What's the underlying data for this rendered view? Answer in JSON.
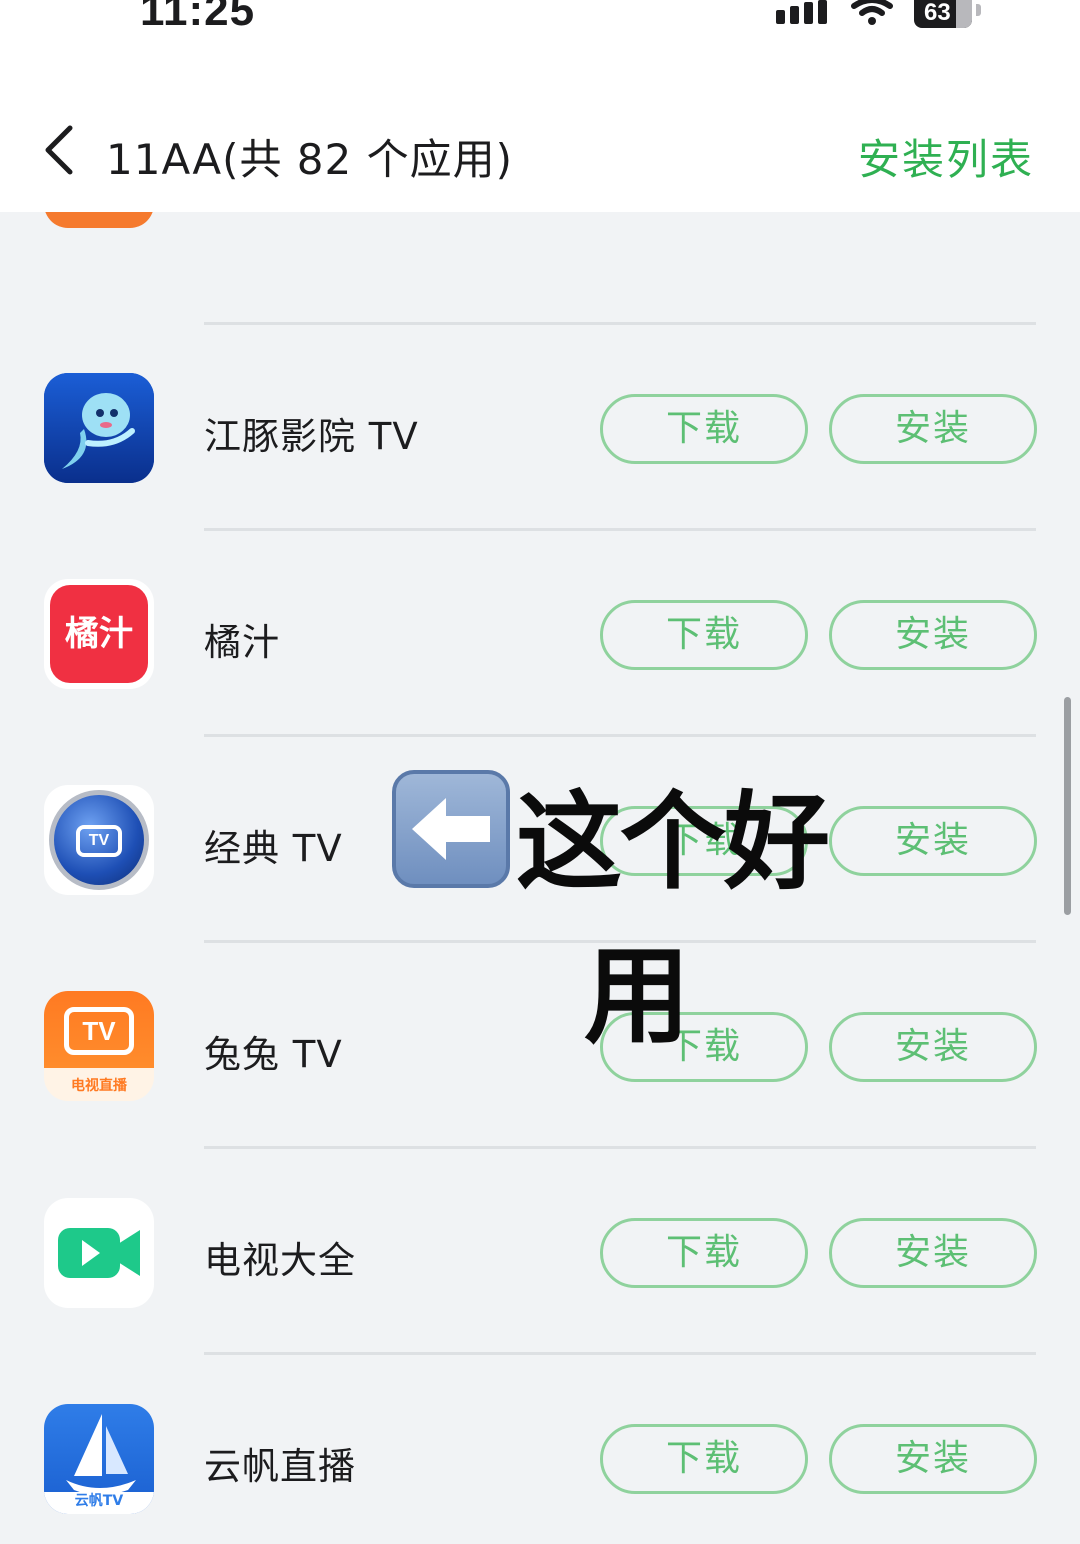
{
  "status_bar": {
    "time": "11:25",
    "battery": "63"
  },
  "header": {
    "title": "11AA(共 82 个应用)",
    "install_list_label": "安装列表"
  },
  "buttons": {
    "download": "下载",
    "install": "安装"
  },
  "apps": [
    {
      "name": "江豚影院 TV",
      "icon": "dolphin-icon"
    },
    {
      "name": "橘汁",
      "icon": "juzhi-logo-icon",
      "icon_text": "橘汁"
    },
    {
      "name": "经典 TV",
      "icon": "classic-tv-icon",
      "icon_text": "TV"
    },
    {
      "name": "兔兔 TV",
      "icon": "tutu-tv-icon",
      "icon_text": "TV",
      "icon_subtext": "电视直播"
    },
    {
      "name": "电视大全",
      "icon": "video-camera-icon"
    },
    {
      "name": "云帆直播",
      "icon": "sailboat-icon",
      "icon_subtext": "云帆TV"
    }
  ],
  "overlay": {
    "line1": "这个好",
    "line2": "用",
    "arrow_icon": "left-arrow-emoji-icon"
  },
  "colors": {
    "accent_green": "#2fb052",
    "button_border": "#8fd29d",
    "list_background": "#f1f3f5"
  }
}
